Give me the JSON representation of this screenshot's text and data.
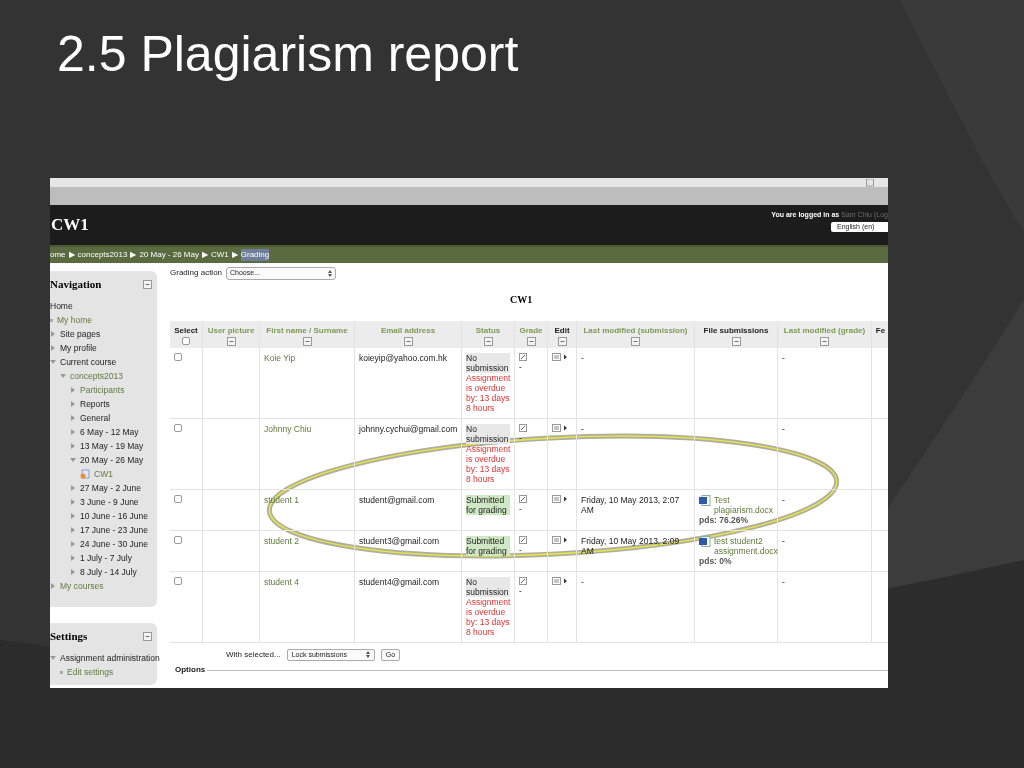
{
  "slide_title": "2.5 Plagiarism report",
  "header": {
    "title": "CW1",
    "login_prefix": "You are logged in as",
    "login_user": "Sam Chiu",
    "login_suffix": "(Log",
    "language": "English (en)"
  },
  "breadcrumb": [
    "ome",
    "concepts2013",
    "20 May - 26 May",
    "CW1",
    "Grading"
  ],
  "breadcrumb_separator": "▶",
  "navigation": {
    "title": "Navigation",
    "items": [
      {
        "label": "Home",
        "kind": "plain",
        "link": false
      },
      {
        "label": "My home",
        "kind": "bullet",
        "link": true
      },
      {
        "label": "Site pages",
        "kind": "branch",
        "expanded": false,
        "link": false
      },
      {
        "label": "My profile",
        "kind": "branch",
        "expanded": false,
        "link": false
      },
      {
        "label": "Current course",
        "kind": "branch",
        "expanded": true,
        "link": false,
        "children": [
          {
            "label": "concepts2013",
            "kind": "branch",
            "expanded": true,
            "link": true,
            "children": [
              {
                "label": "Participants",
                "kind": "branch",
                "expanded": false,
                "link": true
              },
              {
                "label": "Reports",
                "kind": "branch",
                "expanded": false,
                "link": false
              },
              {
                "label": "General",
                "kind": "branch",
                "expanded": false,
                "link": false
              },
              {
                "label": "6 May - 12 May",
                "kind": "branch",
                "expanded": false,
                "link": false
              },
              {
                "label": "13 May - 19 May",
                "kind": "branch",
                "expanded": false,
                "link": false
              },
              {
                "label": "20 May - 26 May",
                "kind": "branch",
                "expanded": true,
                "link": false,
                "children": [
                  {
                    "label": "CW1",
                    "kind": "activity",
                    "link": true
                  }
                ]
              },
              {
                "label": "27 May - 2 June",
                "kind": "branch",
                "expanded": false,
                "link": false
              },
              {
                "label": "3 June - 9 June",
                "kind": "branch",
                "expanded": false,
                "link": false
              },
              {
                "label": "10 June - 16 June",
                "kind": "branch",
                "expanded": false,
                "link": false
              },
              {
                "label": "17 June - 23 June",
                "kind": "branch",
                "expanded": false,
                "link": false
              },
              {
                "label": "24 June - 30 June",
                "kind": "branch",
                "expanded": false,
                "link": false
              },
              {
                "label": "1 July - 7 July",
                "kind": "branch",
                "expanded": false,
                "link": false
              },
              {
                "label": "8 July - 14 July",
                "kind": "branch",
                "expanded": false,
                "link": false
              }
            ]
          }
        ]
      },
      {
        "label": "My courses",
        "kind": "branch",
        "expanded": false,
        "link": true
      }
    ]
  },
  "settings": {
    "title": "Settings",
    "items": [
      {
        "label": "Assignment administration",
        "kind": "branch",
        "expanded": true,
        "link": false,
        "children": [
          {
            "label": "Edit settings",
            "kind": "bullet",
            "link": true
          }
        ]
      }
    ]
  },
  "grading_action": {
    "label": "Grading action",
    "value": "Choose..."
  },
  "table": {
    "title": "CW1",
    "columns": [
      {
        "label": "Select",
        "kind": "checkbox",
        "link": false,
        "checked": false
      },
      {
        "label": "User picture",
        "kind": "collapse",
        "link": true
      },
      {
        "label": "First name / Surname",
        "kind": "collapse",
        "link": true
      },
      {
        "label": "Email address",
        "kind": "collapse",
        "link": true
      },
      {
        "label": "Status",
        "kind": "collapse",
        "link": true
      },
      {
        "label": "Grade",
        "kind": "collapse",
        "link": true
      },
      {
        "label": "Edit",
        "kind": "collapse",
        "link": false
      },
      {
        "label": "Last modified (submission)",
        "kind": "collapse",
        "link": true
      },
      {
        "label": "File submissions",
        "kind": "collapse",
        "link": false
      },
      {
        "label": "Last modified (grade)",
        "kind": "collapse",
        "link": true
      },
      {
        "label": "Fe",
        "kind": "plain",
        "link": false
      }
    ],
    "rows": [
      {
        "checked": false,
        "name": "Koie Yip",
        "email": "koieyip@yahoo.com.hk",
        "status": {
          "kind": "none",
          "text": "No submission",
          "note": "Assignment is overdue by: 13 days 8 hours"
        },
        "grade": "-",
        "last_modified": "-",
        "last_modified_grade": "-"
      },
      {
        "checked": false,
        "name": "Johnny Chiu",
        "email": "johnny.cychui@gmail.com",
        "status": {
          "kind": "none",
          "text": "No submission",
          "note": "Assignment is overdue by: 13 days 8 hours"
        },
        "grade": "-",
        "last_modified": "-",
        "last_modified_grade": "-"
      },
      {
        "checked": false,
        "name": "student 1",
        "email": "student@gmail.com",
        "status": {
          "kind": "submitted",
          "text": "Submitted for grading"
        },
        "grade": "-",
        "last_modified": "Friday, 10 May 2013, 2:07 AM",
        "file": {
          "name": "Test plagiarism.docx",
          "score": "pds: 76.26%"
        },
        "last_modified_grade": "-"
      },
      {
        "checked": false,
        "name": "student 2",
        "email": "student3@gmail.com",
        "status": {
          "kind": "submitted",
          "text": "Submitted for grading"
        },
        "grade": "-",
        "last_modified": "Friday, 10 May 2013, 2:09 AM",
        "file": {
          "name": "test student2 assignment.docx",
          "score": "pds: 0%"
        },
        "last_modified_grade": "-"
      },
      {
        "checked": false,
        "name": "student 4",
        "email": "student4@gmail.com",
        "status": {
          "kind": "none",
          "text": "No submission",
          "note": "Assignment is overdue by: 13 days 8 hours"
        },
        "grade": "-",
        "last_modified": "-",
        "last_modified_grade": "-"
      }
    ]
  },
  "bulk": {
    "label": "With selected...",
    "value": "Lock submissions",
    "button": "Go"
  },
  "options": {
    "title": "Options"
  },
  "highlight": {
    "kind": "ellipse"
  }
}
